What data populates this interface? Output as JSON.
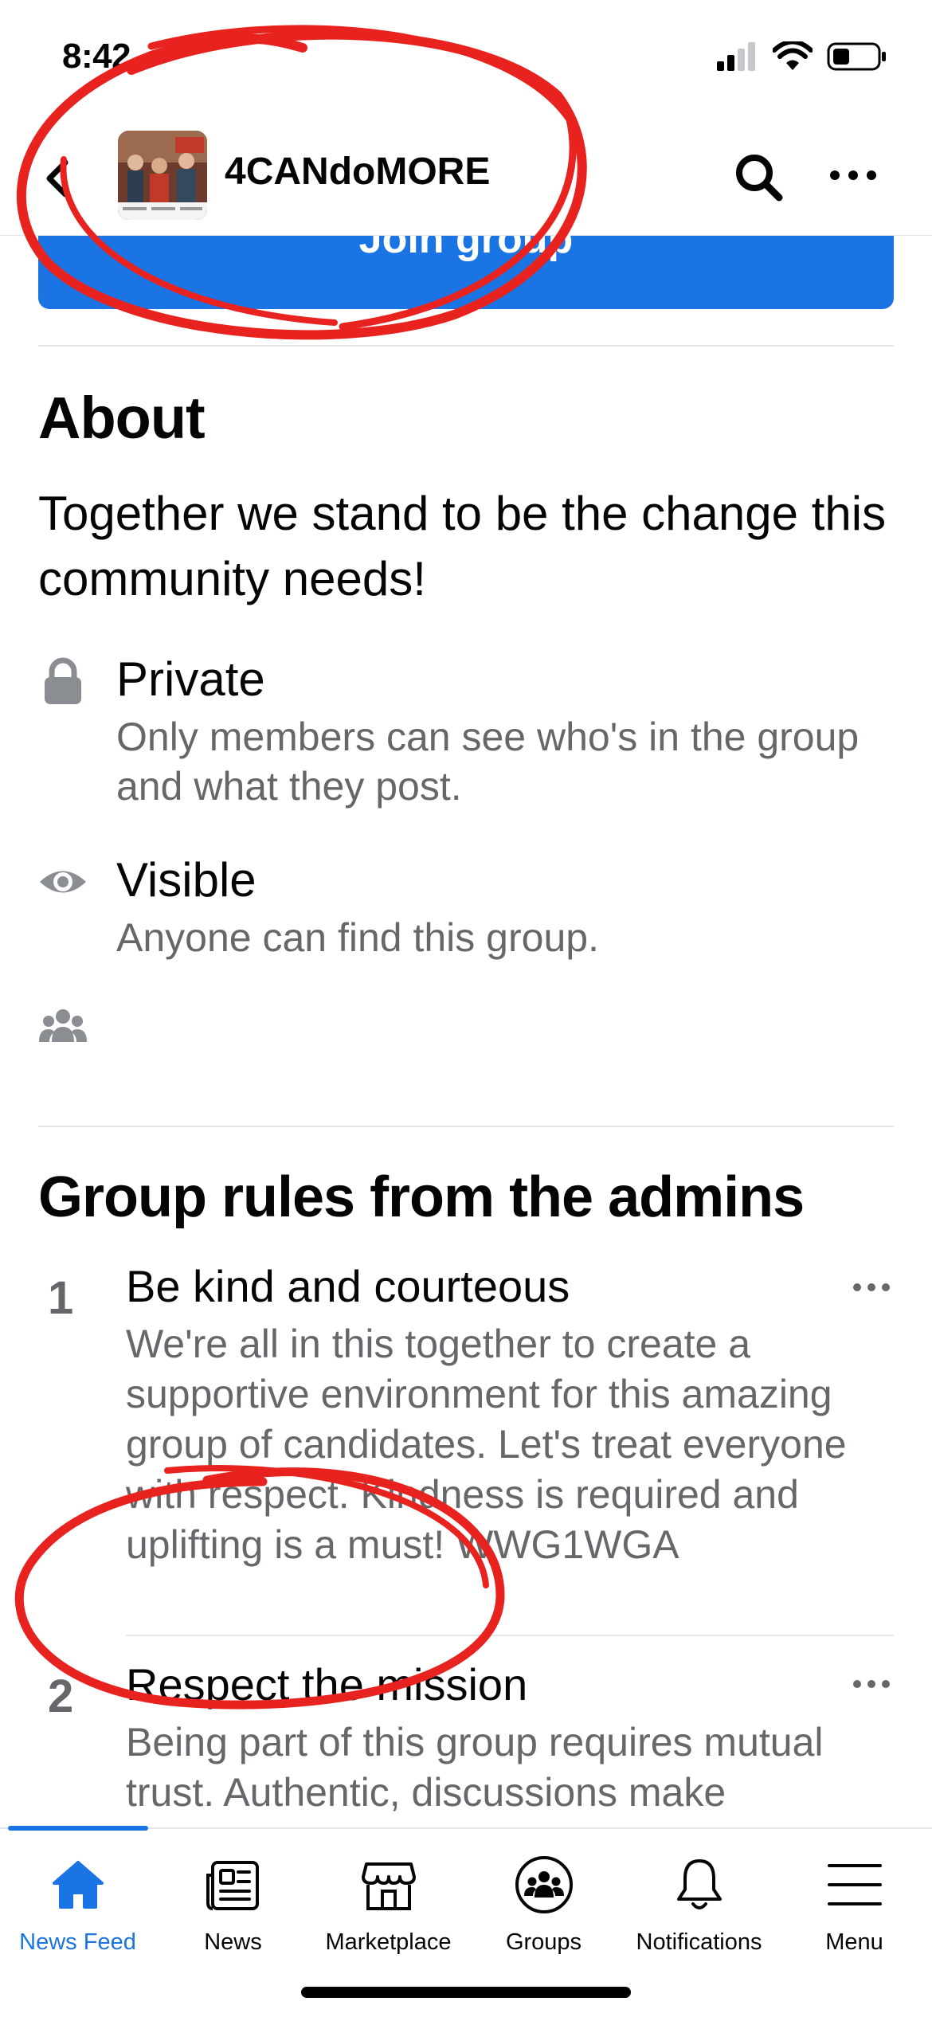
{
  "status_bar": {
    "time": "8:42"
  },
  "header": {
    "group_name": "4CANdoMORE",
    "back_icon": "chevron-left-icon",
    "search_icon": "search-icon",
    "more_icon": "more-horizontal-icon"
  },
  "join_button": {
    "label": "Join group"
  },
  "about": {
    "title": "About",
    "description": "Together we stand to be the change this community needs!",
    "privacy": {
      "title": "Private",
      "subtitle": "Only members can see who's in the group and what they post."
    },
    "visibility": {
      "title": "Visible",
      "subtitle": "Anyone can find this group."
    }
  },
  "rules": {
    "title": "Group rules from the admins",
    "items": [
      {
        "number": "1",
        "title": "Be kind and courteous",
        "body": "We're all in this together to create a supportive environment for this amazing group of candidates. Let's treat everyone with respect. Kindness is required and uplifting is a must! WWG1WGA"
      },
      {
        "number": "2",
        "title": "Respect the mission",
        "body": "Being part of this group requires mutual trust. Authentic, discussions make"
      }
    ]
  },
  "tab_bar": {
    "tabs": [
      {
        "label": "News Feed",
        "icon": "home-icon",
        "active": true
      },
      {
        "label": "News",
        "icon": "newspaper-icon",
        "active": false
      },
      {
        "label": "Marketplace",
        "icon": "storefront-icon",
        "active": false
      },
      {
        "label": "Groups",
        "icon": "groups-icon",
        "active": false
      },
      {
        "label": "Notifications",
        "icon": "bell-icon",
        "active": false
      },
      {
        "label": "Menu",
        "icon": "hamburger-menu-icon",
        "active": false
      }
    ]
  },
  "colors": {
    "accent": "#1b74e4",
    "secondary_text": "#65676b",
    "annotation": "#e8231f"
  }
}
